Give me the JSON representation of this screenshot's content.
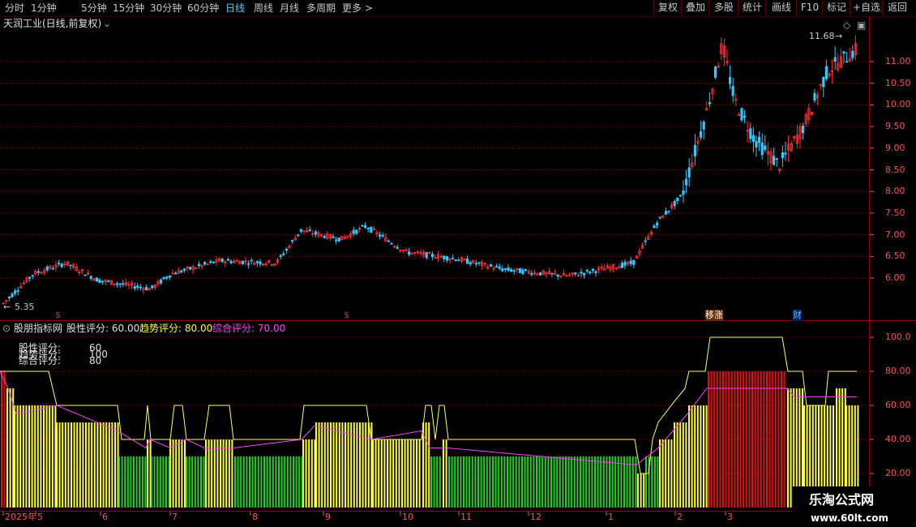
{
  "periods": [
    "分时",
    "1分钟",
    "5分钟",
    "15分钟",
    "30分钟",
    "60分钟",
    "日线",
    "周线",
    "月线",
    "多周期",
    "更多"
  ],
  "active_period": "日线",
  "more_arrow": ">",
  "tools": [
    "复权",
    "叠加",
    "多股",
    "统计",
    "画线",
    "F10",
    "标记",
    "+自选",
    "返回"
  ],
  "stock_title": "天润工业(日线,前复权)",
  "price_high_label": "11.68",
  "price_low_label": "5.35",
  "price_axis": [
    "11.00",
    "10.50",
    "10.00",
    "9.50",
    "9.00",
    "8.50",
    "8.00",
    "7.50",
    "7.00",
    "6.50",
    "6.00"
  ],
  "event_markers": [
    {
      "text": "$",
      "color": "#e03030"
    },
    {
      "text": "$",
      "color": "#e03030"
    },
    {
      "text": "移涨",
      "color": "#ffffff"
    },
    {
      "text": "财",
      "color": "#5fb0ff"
    }
  ],
  "indicator": {
    "name": "股朋指标网",
    "stock_score_label": "股性评分: 60.00",
    "trend_score_label": "趋势评分: 80.00",
    "overall_score_label": "综合评分: 70.00",
    "overlay_rows": [
      {
        "label": "股性评分:",
        "value": "60"
      },
      {
        "label": "趋势评分:",
        "value": "100"
      },
      {
        "label": "综合评分:",
        "value": "80"
      }
    ],
    "axis": [
      "100.0",
      "80.00",
      "60.00",
      "40.00",
      "20.00"
    ]
  },
  "date_axis": [
    "2025年",
    "5",
    "6",
    "7",
    "8",
    "9",
    "10",
    "11",
    "12",
    "1",
    "2",
    "3"
  ],
  "watermark": {
    "line1": "乐淘公式网",
    "line2": "www.60lt.com"
  },
  "colors": {
    "up": "#ff3030",
    "down": "#30c8ff",
    "yellow": "#ffff30",
    "green": "#20d020",
    "red_bar": "#e01010",
    "grid": "#8a0000",
    "trend": "#ffff60",
    "score": "#ff40ff"
  },
  "chart_data": [
    {
      "type": "candlestick",
      "title": "天润工业(日线,前复权)",
      "approx_close_path": [
        {
          "x": "2025-04",
          "y": 5.4
        },
        {
          "x": "2025-04-20",
          "y": 6.3
        },
        {
          "x": "2025-05",
          "y": 6.2
        },
        {
          "x": "2025-06",
          "y": 5.8
        },
        {
          "x": "2025-07",
          "y": 6.1
        },
        {
          "x": "2025-08",
          "y": 6.4
        },
        {
          "x": "2025-09",
          "y": 7.0
        },
        {
          "x": "2025-10",
          "y": 6.6
        },
        {
          "x": "2025-11",
          "y": 6.4
        },
        {
          "x": "2025-12",
          "y": 6.1
        },
        {
          "x": "2026-01",
          "y": 6.3
        },
        {
          "x": "2026-02",
          "y": 8.2
        },
        {
          "x": "2026-03",
          "y": 10.5
        },
        {
          "x": "2026-04",
          "y": 9.0
        },
        {
          "x": "2026-05",
          "y": 11.2
        }
      ],
      "high": 11.68,
      "low": 5.35,
      "ylim": [
        5.2,
        11.9
      ]
    },
    {
      "type": "bar",
      "title": "股朋指标网",
      "series": [
        {
          "name": "股性评分",
          "last": 60
        },
        {
          "name": "趋势评分",
          "last": 80
        },
        {
          "name": "综合评分",
          "last": 70
        }
      ],
      "ylim": [
        0,
        110
      ]
    }
  ]
}
